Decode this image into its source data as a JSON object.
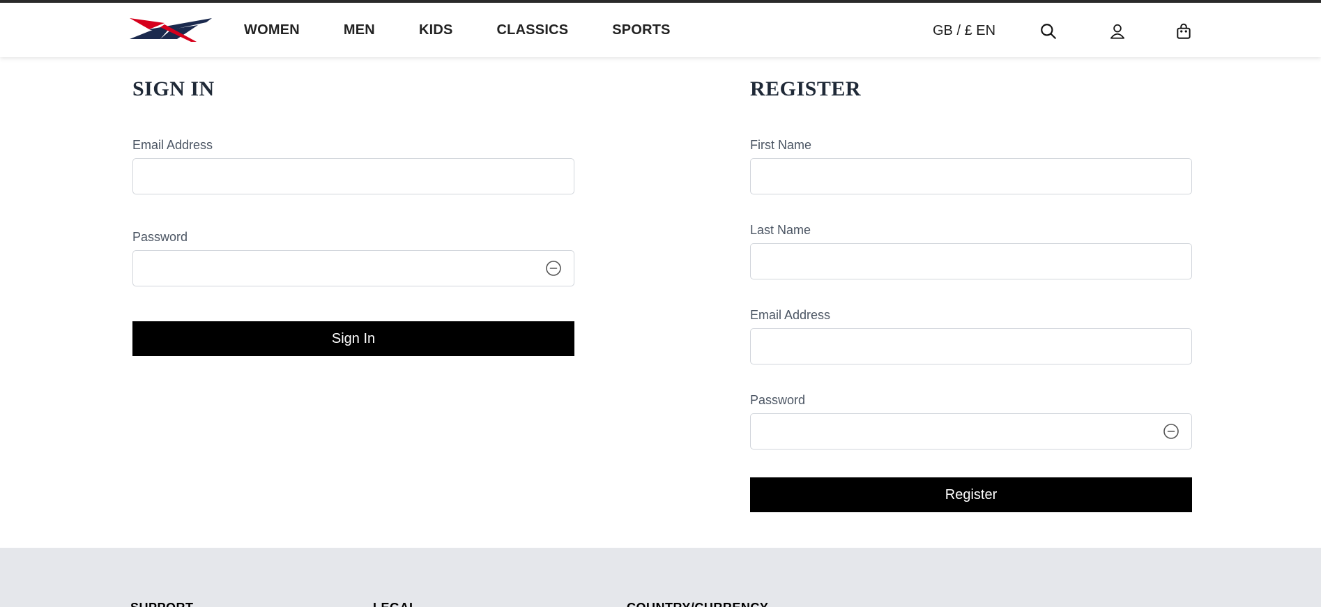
{
  "header": {
    "logo_icon": "reebok-delta-logo-icon",
    "nav": [
      "WOMEN",
      "MEN",
      "KIDS",
      "CLASSICS",
      "SPORTS"
    ],
    "locale": "GB / £ EN",
    "icons": [
      "search-icon",
      "user-icon",
      "bag-icon"
    ]
  },
  "sign_in": {
    "title": "SIGN IN",
    "email_label": "Email Address",
    "email_value": "",
    "password_label": "Password",
    "password_value": "",
    "button": "Sign In"
  },
  "register": {
    "title": "REGISTER",
    "first_name_label": "First Name",
    "first_name_value": "",
    "last_name_label": "Last Name",
    "last_name_value": "",
    "email_label": "Email Address",
    "email_value": "",
    "password_label": "Password",
    "password_value": "",
    "button": "Register"
  },
  "footer": {
    "headings": [
      "SUPPORT",
      "LEGAL",
      "COUNTRY/CURRENCY"
    ]
  },
  "colors": {
    "logo_red": "#d6001c",
    "logo_navy": "#1b2a4e",
    "button_bg": "#000000",
    "footer_bg": "#e5e7eb"
  }
}
